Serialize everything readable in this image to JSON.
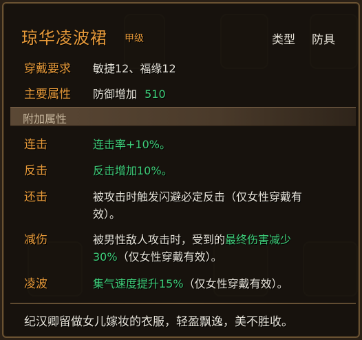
{
  "item": {
    "name": "琼华凌波裙",
    "grade": "甲级",
    "type_label": "类型",
    "type_value": "防具"
  },
  "requirements": {
    "label": "穿戴要求",
    "value": "敏捷12、福缘12"
  },
  "main_attr": {
    "label": "主要属性",
    "text": "防御增加",
    "value": "510"
  },
  "extra_attrs_title": "附加属性",
  "attrs": [
    {
      "label": "连击",
      "green": "连击率+10%。",
      "rest": ""
    },
    {
      "label": "反击",
      "green": "反击增加10%。",
      "rest": ""
    },
    {
      "label": "还击",
      "line1": "被攻击时触发闪避必定反击（仅女性穿戴有",
      "line2": "效）。"
    },
    {
      "label": "减伤",
      "line1_white": "被男性敌人攻击时，受到的",
      "line1_green": "最终伤害减少",
      "line2_green": "30%",
      "line2_white": "（仅女性穿戴有效）。"
    },
    {
      "label": "凌波",
      "green": "集气速度提升15%",
      "rest": "（仅女性穿戴有效）。"
    }
  ],
  "description": "纪汉卿留做女儿嫁妆的衣服，轻盈飘逸，美不胜收。",
  "colors": {
    "title": "#e79a3a",
    "green": "#3fcf7a",
    "white": "#e8e4da"
  }
}
